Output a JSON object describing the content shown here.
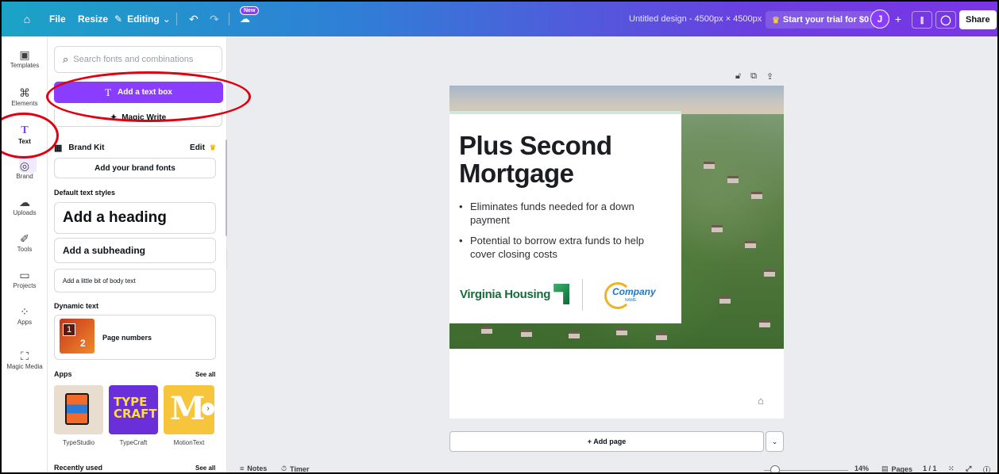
{
  "topbar": {
    "file": "File",
    "resize": "Resize",
    "editing": "Editing",
    "new_badge": "New",
    "design_title": "Untitled design - 4500px × 4500px",
    "trial": "Start your trial for $0",
    "avatar_initial": "J",
    "share": "Share"
  },
  "rail": [
    {
      "label": "Templates",
      "icon": "templates-icon"
    },
    {
      "label": "Elements",
      "icon": "elements-icon"
    },
    {
      "label": "Text",
      "icon": "text-icon"
    },
    {
      "label": "Brand",
      "icon": "brand-icon"
    },
    {
      "label": "Uploads",
      "icon": "uploads-icon"
    },
    {
      "label": "Tools",
      "icon": "tools-icon"
    },
    {
      "label": "Projects",
      "icon": "projects-icon"
    },
    {
      "label": "Apps",
      "icon": "apps-icon"
    },
    {
      "label": "Magic Media",
      "icon": "magic-media-icon"
    }
  ],
  "panel": {
    "search_placeholder": "Search fonts and combinations",
    "add_text_box": "Add a text box",
    "magic_write": "Magic Write",
    "brand_kit": "Brand Kit",
    "edit": "Edit",
    "add_brand_fonts": "Add your brand fonts",
    "default_text_styles": "Default text styles",
    "add_heading": "Add a heading",
    "add_subheading": "Add a subheading",
    "add_body": "Add a little bit of body text",
    "dynamic_text": "Dynamic text",
    "page_numbers": "Page numbers",
    "apps": "Apps",
    "see_all": "See all",
    "app_names": [
      "TypeStudio",
      "TypeCraft",
      "MotionText"
    ],
    "recently_used": "Recently used"
  },
  "canvas": {
    "headline": "Plus Second Mortgage",
    "bullets": [
      "Eliminates funds needed for a down payment",
      "Potential to borrow extra funds to help cover closing costs"
    ],
    "logo_vh": "Virginia Housing",
    "logo_company": "Company",
    "logo_company_sub": "NAME",
    "add_page": "+ Add page"
  },
  "bottombar": {
    "notes": "Notes",
    "timer": "Timer",
    "zoom": "14%",
    "pages": "Pages",
    "page_count": "1 / 1"
  },
  "colors": {
    "accent": "#8b3dff",
    "annotation": "#e0000f"
  }
}
